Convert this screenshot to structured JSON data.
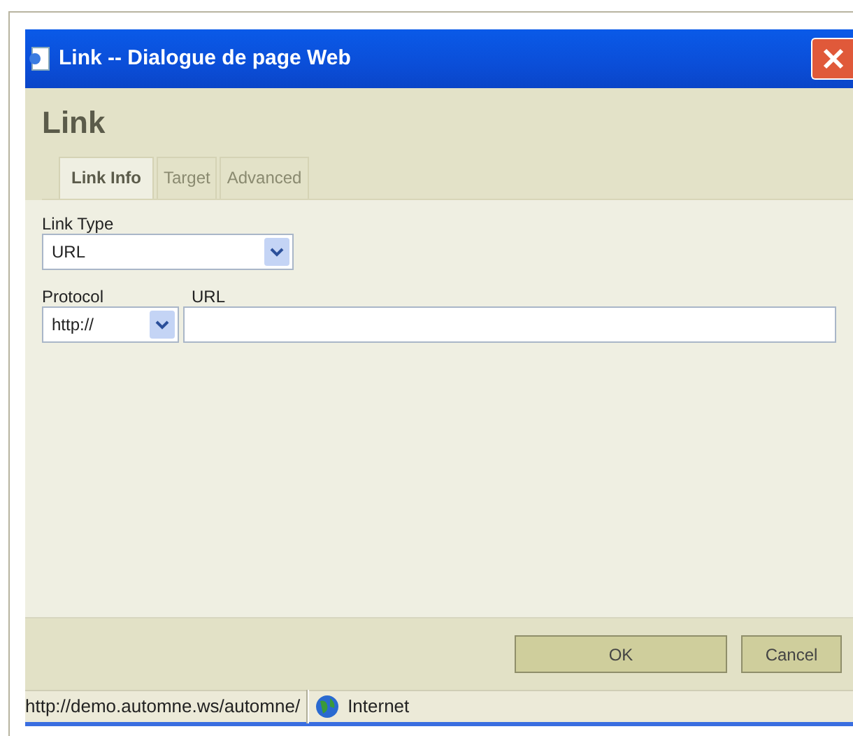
{
  "window": {
    "title": "Link -- Dialogue de page Web"
  },
  "header": {
    "title": "Link"
  },
  "tabs": [
    {
      "label": "Link Info",
      "selected": true
    },
    {
      "label": "Target",
      "selected": false
    },
    {
      "label": "Advanced",
      "selected": false
    }
  ],
  "link_type": {
    "label": "Link Type",
    "value": "URL"
  },
  "protocol": {
    "label": "Protocol",
    "value": "http://"
  },
  "url": {
    "label": "URL"
  },
  "buttons": [
    "OK",
    "Cancel"
  ],
  "status_bar": {
    "address": "http://demo.automne.ws/automne/",
    "zone": "Internet"
  }
}
